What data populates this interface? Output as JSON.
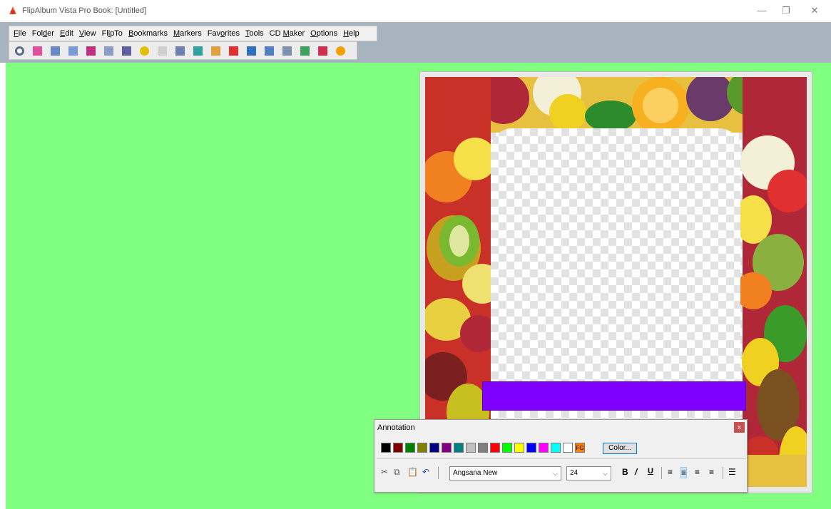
{
  "window": {
    "title": "FlipAlbum Vista Pro   Book: [Untitled]",
    "controls": {
      "minimize": "—",
      "restore": "❐",
      "close": "✕"
    }
  },
  "menu": {
    "items": [
      {
        "label": "File",
        "key": "F"
      },
      {
        "label": "Folder",
        "key": "d"
      },
      {
        "label": "Edit",
        "key": "E"
      },
      {
        "label": "View",
        "key": "V"
      },
      {
        "label": "FlipTo",
        "key": "i"
      },
      {
        "label": "Bookmarks",
        "key": "B"
      },
      {
        "label": "Markers",
        "key": "M"
      },
      {
        "label": "Favorites",
        "key": "o"
      },
      {
        "label": "Tools",
        "key": "T"
      },
      {
        "label": "CD Maker",
        "key": "M"
      },
      {
        "label": "Options",
        "key": "O"
      },
      {
        "label": "Help",
        "key": "H"
      }
    ]
  },
  "toolbar": {
    "icons": [
      "eye-icon",
      "book-pink-icon",
      "open-book-icon",
      "pages-icon",
      "next-page-icon",
      "book-icon",
      "print-icon",
      "add-icon",
      "rotate-icon",
      "columns-icon",
      "arrow-icon",
      "album-icon",
      "target-icon",
      "frame-icon",
      "slide-icon",
      "screen-icon",
      "globe-icon",
      "pointer-icon",
      "star-icon"
    ],
    "colors": [
      "#5a6b8c",
      "#e0509a",
      "#6a88c8",
      "#7a9ad8",
      "#c03080",
      "#8a9cc8",
      "#6060a0",
      "#e0c000",
      "#d0d0d0",
      "#7080b0",
      "#30a0a0",
      "#e0a040",
      "#e03030",
      "#3070c0",
      "#5080c0",
      "#8090b0",
      "#40a060",
      "#d03050",
      "#f0a000"
    ]
  },
  "workspace": {
    "background": "#80ff80"
  },
  "annotation": {
    "title": "Annotation",
    "close": "x",
    "swatches": [
      "#000000",
      "#800000",
      "#008000",
      "#808000",
      "#000080",
      "#800080",
      "#008080",
      "#c0c0c0",
      "#808080",
      "#ff0000",
      "#00ff00",
      "#ffff00",
      "#0000ff",
      "#ff00ff",
      "#00ffff",
      "#ffffff"
    ],
    "fg_label": "FG",
    "fg_color": "#ff8000",
    "color_button": "Color...",
    "font": "Angsana New",
    "size": "24",
    "bold": "B",
    "italic": "𝘐",
    "underline": "U"
  },
  "text_box": {
    "color": "#8000ff"
  }
}
